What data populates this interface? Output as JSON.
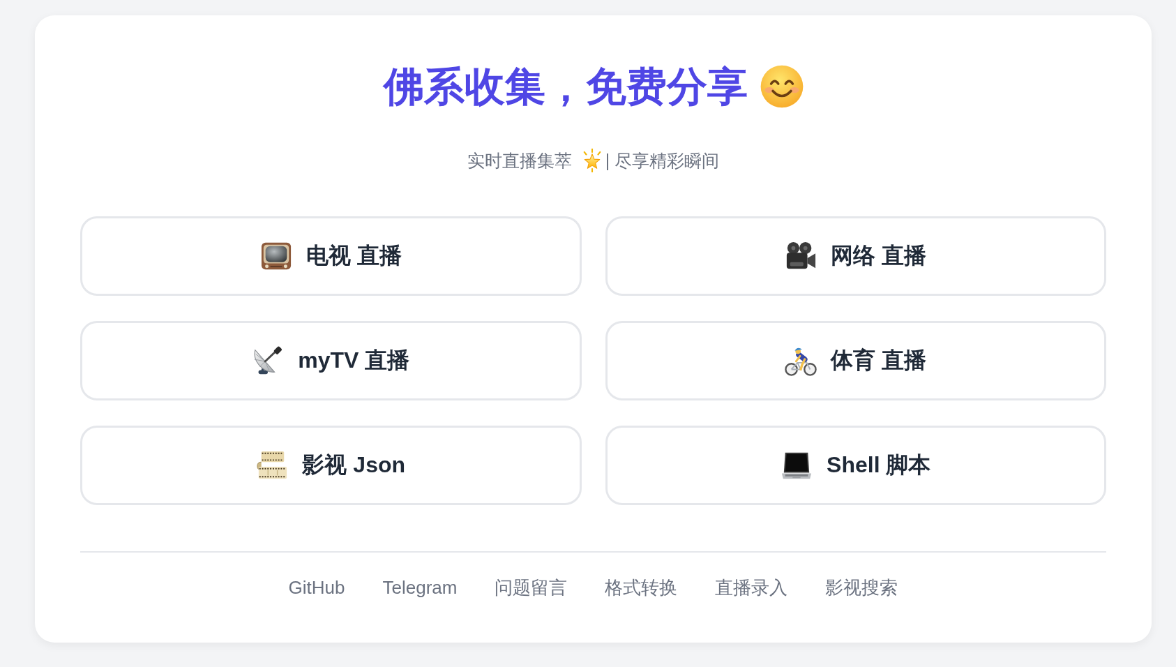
{
  "header": {
    "title": "佛系收集，免费分享",
    "subtitle": {
      "text_before": "实时直播集萃",
      "text_after": "| 尽享精彩瞬间"
    }
  },
  "category_buttons": [
    {
      "label": "电视 直播"
    },
    {
      "label": "网络 直播"
    },
    {
      "label": "myTV 直播"
    },
    {
      "label": "体育 直播"
    },
    {
      "label": "影视 Json"
    },
    {
      "label": "Shell 脚本"
    }
  ],
  "footer_links": [
    "GitHub",
    "Telegram",
    "问题留言",
    "格式转换",
    "直播录入",
    "影视搜索"
  ]
}
